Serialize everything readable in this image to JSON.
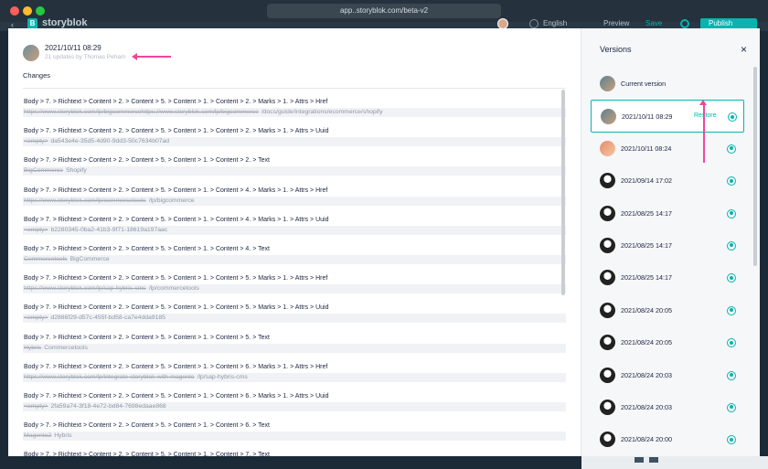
{
  "browser": {
    "url": "app..storyblok.com/beta-v2"
  },
  "app_header": {
    "brand": "storyblok",
    "logo_letter": "B",
    "language": "English",
    "preview": "Preview",
    "save": "Save",
    "publish": "Publish"
  },
  "version_header": {
    "date": "2021/10/11 08:29",
    "subtitle": "21 updates by Thomas Peham"
  },
  "changes_title": "Changes",
  "changes": [
    {
      "path": "Body > 7. > Richtext > Content > 2. > Content > 5. > Content > 1. > Content > 2. > Marks > 1. > Attrs > Href",
      "old": "https://www.storyblok.com/lp/bigcommercehttps://www.storyblok.com/lp/bigcommerce",
      "new": "/docs/guide/integrations/ecommerce/shopify"
    },
    {
      "path": "Body > 7. > Richtext > Content > 2. > Content > 5. > Content > 1. > Content > 2. > Marks > 1. > Attrs > Uuid",
      "old": "<empty>",
      "new": "da543e4e-35d5-4d90-9dd3-50c7634b07ad"
    },
    {
      "path": "Body > 7. > Richtext > Content > 2. > Content > 5. > Content > 1. > Content > 2. > Text",
      "old": "BigCommerce",
      "new": "Shopify"
    },
    {
      "path": "Body > 7. > Richtext > Content > 2. > Content > 5. > Content > 1. > Content > 4. > Marks > 1. > Attrs > Href",
      "old": "https://www.storyblok.com/lp/commercetools",
      "new": "/lp/bigcommerce"
    },
    {
      "path": "Body > 7. > Richtext > Content > 2. > Content > 5. > Content > 1. > Content > 4. > Marks > 1. > Attrs > Uuid",
      "old": "<empty>",
      "new": "b2280345-0ba2-41b3-9f71-18619a197aac"
    },
    {
      "path": "Body > 7. > Richtext > Content > 2. > Content > 5. > Content > 1. > Content > 4. > Text",
      "old": "Commercetools",
      "new": "BigCommerce"
    },
    {
      "path": "Body > 7. > Richtext > Content > 2. > Content > 5. > Content > 1. > Content > 5. > Marks > 1. > Attrs > Href",
      "old": "https://www.storyblok.com/lp/sap-hybris-cms",
      "new": "/lp/commercetools"
    },
    {
      "path": "Body > 7. > Richtext > Content > 2. > Content > 5. > Content > 1. > Content > 5. > Marks > 1. > Attrs > Uuid",
      "old": "<empty>",
      "new": "d2886f29-d57c-455f-bd58-ca7e4dda9185"
    },
    {
      "path": "Body > 7. > Richtext > Content > 2. > Content > 5. > Content > 1. > Content > 5. > Text",
      "old": "Hybris",
      "new": "Commercetools"
    },
    {
      "path": "Body > 7. > Richtext > Content > 2. > Content > 5. > Content > 1. > Content > 6. > Marks > 1. > Attrs > Href",
      "old": "https://www.storyblok.com/lp/integrate-storyblok-with-magento",
      "new": "/lp/sap-hybris-cms"
    },
    {
      "path": "Body > 7. > Richtext > Content > 2. > Content > 5. > Content > 1. > Content > 6. > Marks > 1. > Attrs > Uuid",
      "old": "<empty>",
      "new": "2fa59a74-3f18-4e72-bd84-7698edaae868"
    },
    {
      "path": "Body > 7. > Richtext > Content > 2. > Content > 5. > Content > 1. > Content > 6. > Text",
      "old": "Magento2",
      "new": "Hybris"
    },
    {
      "path": "Body > 7. > Richtext > Content > 2. > Content > 5. > Content > 1. > Content > 7. > Text",
      "old": "",
      "new": ""
    }
  ],
  "versions_panel": {
    "title": "Versions",
    "close": "×",
    "restore_label": "Restore",
    "items": [
      {
        "label": "Current version",
        "avatar": "tp",
        "selected": false,
        "radio": false
      },
      {
        "label": "2021/10/11 08:29",
        "avatar": "tp",
        "selected": true,
        "radio": true
      },
      {
        "label": "2021/10/11 08:24",
        "avatar": "or",
        "selected": false,
        "radio": true
      },
      {
        "label": "2021/09/14 17:02",
        "avatar": "dk",
        "selected": false,
        "radio": true
      },
      {
        "label": "2021/08/25 14:17",
        "avatar": "dk",
        "selected": false,
        "radio": true
      },
      {
        "label": "2021/08/25 14:17",
        "avatar": "dk",
        "selected": false,
        "radio": true
      },
      {
        "label": "2021/08/25 14:17",
        "avatar": "dk",
        "selected": false,
        "radio": true
      },
      {
        "label": "2021/08/24 20:05",
        "avatar": "dk",
        "selected": false,
        "radio": true
      },
      {
        "label": "2021/08/24 20:05",
        "avatar": "dk",
        "selected": false,
        "radio": true
      },
      {
        "label": "2021/08/24 20:03",
        "avatar": "dk",
        "selected": false,
        "radio": true
      },
      {
        "label": "2021/08/24 20:03",
        "avatar": "dk",
        "selected": false,
        "radio": true
      },
      {
        "label": "2021/08/24 20:00",
        "avatar": "dk",
        "selected": false,
        "radio": true
      }
    ]
  },
  "colors": {
    "accent": "#09b3af",
    "annotation": "#ec4899",
    "text": "#1b243f"
  }
}
